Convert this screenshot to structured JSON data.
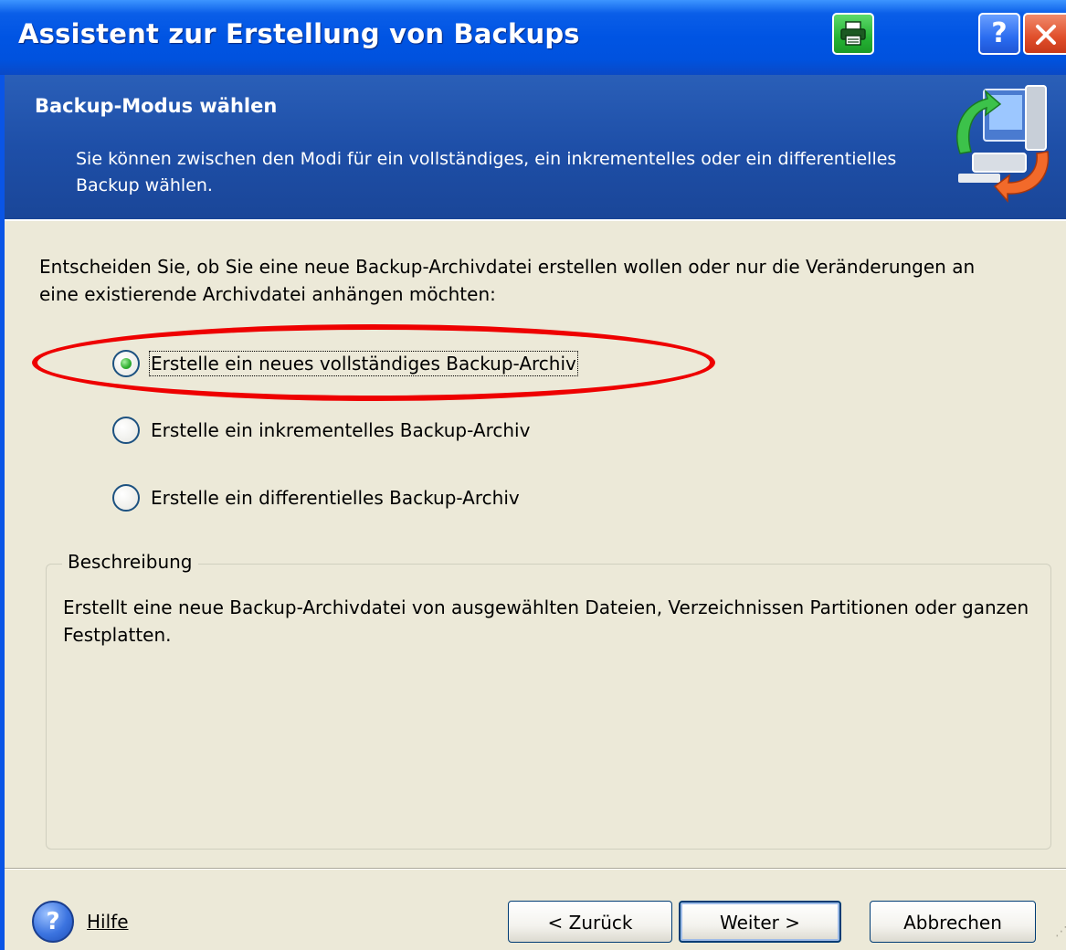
{
  "window": {
    "title": "Assistent zur Erstellung von Backups",
    "title_icons": [
      "printer-icon",
      "help-icon",
      "close-icon"
    ],
    "help_glyph": "?"
  },
  "header": {
    "title": "Backup-Modus wählen",
    "description": "Sie können zwischen den Modi für ein vollständiges, ein inkrementelles oder ein differentielles Backup wählen.",
    "icon": "backup-computer-icon"
  },
  "body": {
    "intro": "Entscheiden Sie, ob Sie eine neue Backup-Archivdatei erstellen wollen oder nur die Veränderungen an eine existierende Archivdatei anhängen möchten:",
    "options": [
      {
        "label": "Erstelle ein neues vollständiges Backup-Archiv",
        "checked": true
      },
      {
        "label": "Erstelle ein inkrementelles Backup-Archiv",
        "checked": false
      },
      {
        "label": "Erstelle ein differentielles Backup-Archiv",
        "checked": false
      }
    ],
    "description_group": {
      "legend": "Beschreibung",
      "text": "Erstellt eine neue Backup-Archivdatei von ausgewählten Dateien, Verzeichnissen Partitionen oder ganzen Festplatten."
    }
  },
  "footer": {
    "help_label": "Hilfe",
    "help_glyph": "?",
    "back_label": "< Zurück",
    "next_label": "Weiter >",
    "cancel_label": "Abbrechen"
  },
  "colors": {
    "titlebar": "#0054e3",
    "header": "#1e4fa8",
    "dialog_bg": "#ece9d8",
    "annotation": "#ee0000",
    "radio_checked": "#2fae2f"
  }
}
